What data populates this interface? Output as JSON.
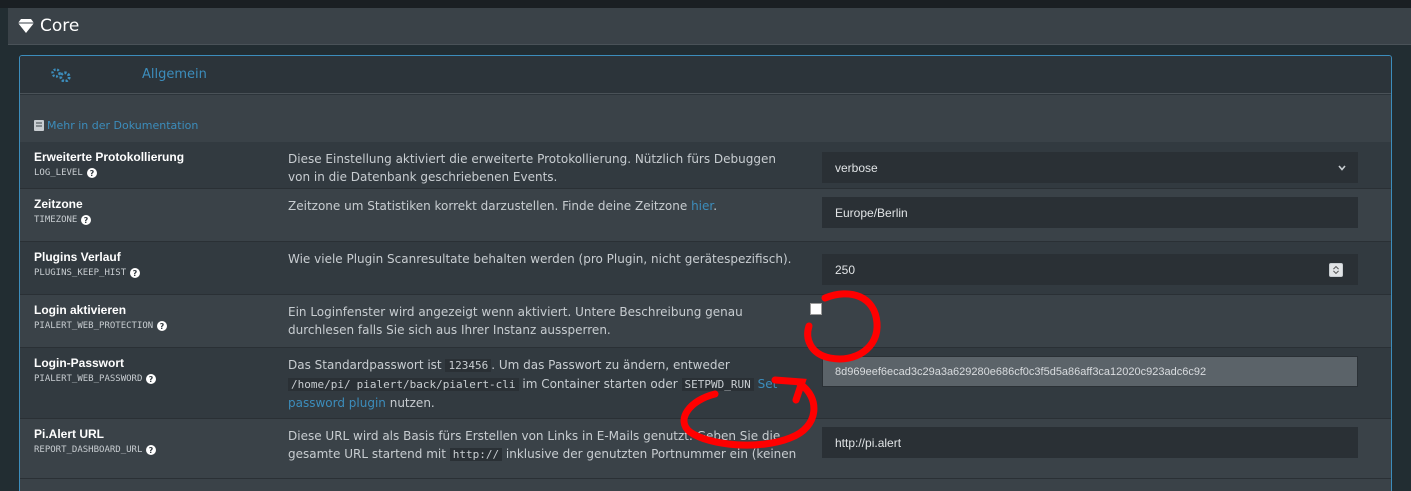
{
  "core": {
    "title": "Core"
  },
  "tabs": [
    {
      "label": "Allgemein"
    }
  ],
  "doc_link": "Mehr in der Dokumentation",
  "settings": [
    {
      "name": "Erweiterte Protokollierung",
      "code": "LOG_LEVEL",
      "description": "Diese Einstellung aktiviert die erweiterte Protokollierung. Nützlich fürs Debuggen von in die Datenbank geschriebenen Events.",
      "value": "verbose"
    },
    {
      "name": "Zeitzone",
      "code": "TIMEZONE",
      "description_pre": "Zeitzone um Statistiken korrekt darzustellen. Finde deine Zeitzone ",
      "description_link": "hier",
      "description_post": ".",
      "value": "Europe/Berlin"
    },
    {
      "name": "Plugins Verlauf",
      "code": "PLUGINS_KEEP_HIST",
      "description": "Wie viele Plugin Scanresultate behalten werden (pro Plugin, nicht gerätespezifisch).",
      "value": "250"
    },
    {
      "name": "Login aktivieren",
      "code": "PIALERT_WEB_PROTECTION",
      "description": "Ein Loginfenster wird angezeigt wenn aktiviert. Untere Beschreibung genau durchlesen falls Sie sich aus Ihrer Instanz aussperren.",
      "checked": false
    },
    {
      "name": "Login-Passwort",
      "code": "PIALERT_WEB_PASSWORD",
      "description_t1": "Das Standardpasswort ist ",
      "description_code1": "123456",
      "description_t2": ". Um das Passwort zu ändern, entweder ",
      "description_code2": "/home/pi/",
      "description_code3": "pialert/back/pialert-cli",
      "description_t3": " im Container starten oder ",
      "description_code4": "SETPWD_RUN",
      "description_link": "Set password plugin",
      "description_t4": " nutzen.",
      "value": "8d969eef6ecad3c29a3a629280e686cf0c3f5d5a86aff3ca12020c923adc6c92"
    },
    {
      "name": "Pi.Alert URL",
      "code": "REPORT_DASHBOARD_URL",
      "description_t1": "Diese URL wird als Basis fürs Erstellen von Links in E-Mails genutzt. Geben Sie die gesamte URL startend mit ",
      "description_code1": "http://",
      "description_t2": " inklusive der genutzten Portnummer ein (keinen",
      "value": "http://pi.alert"
    }
  ],
  "colors": {
    "accent": "#3c8dbc",
    "annotation": "#ff0000"
  }
}
